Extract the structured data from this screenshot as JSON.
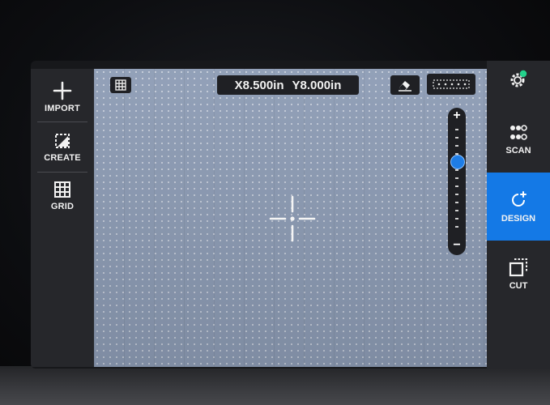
{
  "left_toolbar": {
    "items": [
      {
        "label": "IMPORT",
        "icon": "plus-icon"
      },
      {
        "label": "CREATE",
        "icon": "create-shape-icon"
      },
      {
        "label": "GRID",
        "icon": "grid-icon"
      }
    ]
  },
  "canvas": {
    "coords": {
      "x": "X8.500in",
      "y": "Y8.000in"
    }
  },
  "zoom": {
    "plus": "+",
    "minus": "−"
  },
  "right_nav": {
    "items": [
      {
        "label": "",
        "icon": "settings-gear-icon",
        "active": false
      },
      {
        "label": "SCAN",
        "icon": "scan-icon",
        "active": false
      },
      {
        "label": "DESIGN",
        "icon": "design-icon",
        "active": true
      },
      {
        "label": "CUT",
        "icon": "cut-icon",
        "active": false
      }
    ]
  },
  "colors": {
    "accent": "#1479e6",
    "notification_dot": "#23d18b",
    "toolbar_bg": "#26272b",
    "canvas_bg": "#8d9cb5"
  }
}
